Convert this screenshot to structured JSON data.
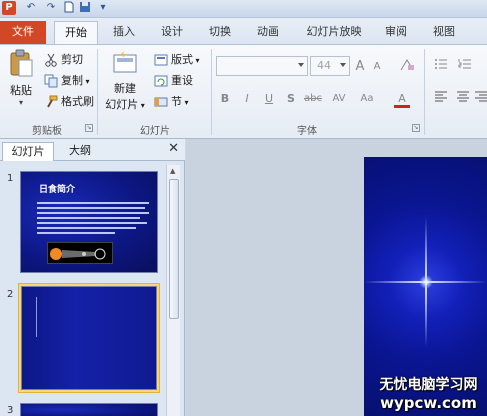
{
  "qat": {
    "app_letter": "P",
    "undo": "↶",
    "redo": "↷",
    "save": "▪",
    "more": "▾"
  },
  "tabs": {
    "file": "文件",
    "home": "开始",
    "insert": "插入",
    "design": "设计",
    "transitions": "切换",
    "animations": "动画",
    "slideshow": "幻灯片放映",
    "review": "审阅",
    "view": "视图"
  },
  "ribbon": {
    "clipboard": {
      "paste": "粘贴",
      "cut": "剪切",
      "copy": "复制",
      "format_painter": "格式刷",
      "label": "剪贴板"
    },
    "slides": {
      "new_slide": "新建",
      "new_slide_line2": "幻灯片",
      "layout": "版式",
      "reset": "重设",
      "section": "节",
      "label": "幻灯片"
    },
    "font": {
      "font_size": "44",
      "grow": "A",
      "shrink": "A",
      "bold": "B",
      "italic": "I",
      "underline": "U",
      "shadow": "S",
      "strike": "abc",
      "spacing": "AV",
      "case": "Aa",
      "color": "A",
      "label": "字体"
    }
  },
  "panel": {
    "tab_slides": "幻灯片",
    "tab_outline": "大纲",
    "close": "✕"
  },
  "slides": [
    {
      "number": "1",
      "title": "日食简介"
    },
    {
      "number": "2"
    },
    {
      "number": "3"
    }
  ],
  "watermark": {
    "line1": "无忧电脑学习网",
    "line2": "wypcw.com"
  },
  "colors": {
    "file_tab": "#d24726",
    "slide_bg": "#0d1785",
    "selection": "#f8d77a"
  }
}
